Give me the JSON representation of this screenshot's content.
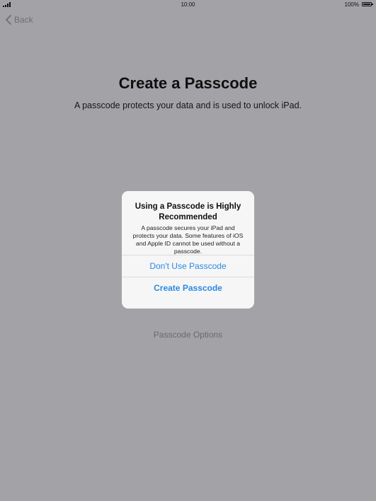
{
  "status_bar": {
    "time": "10:00",
    "battery_percent": "100%",
    "icons": [
      "signal-icon",
      "battery-icon"
    ],
    "battery_level": 1.0
  },
  "nav": {
    "back_label": "Back",
    "back_icon": "chevron-left-icon"
  },
  "page": {
    "title": "Create a Passcode",
    "subtitle": "A passcode protects your data and is used to unlock iPad.",
    "options_link": "Passcode Options"
  },
  "alert": {
    "title": "Using a Passcode is Highly Recommended",
    "message": "A passcode secures your iPad and protects your data. Some features of iOS and Apple ID cannot be used without a passcode.",
    "buttons": [
      "Don't Use Passcode",
      "Create Passcode"
    ]
  },
  "colors": {
    "background": "#a3a2a6",
    "alert_background": "#f6f6f7",
    "accent": "#2a8ae0"
  }
}
